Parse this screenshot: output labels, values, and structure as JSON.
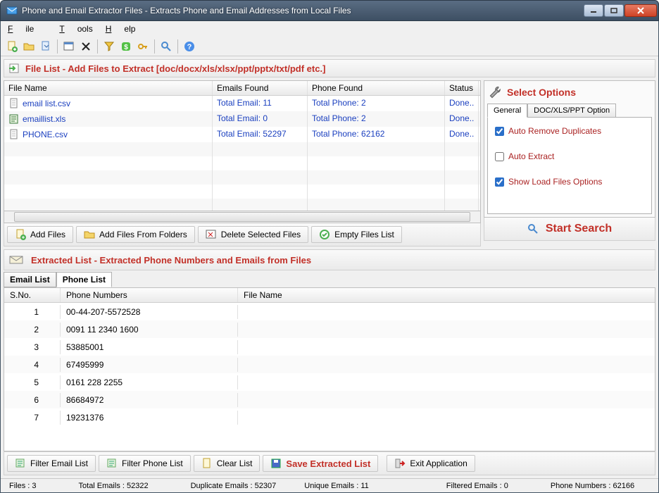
{
  "title": "Phone and Email Extractor Files  -  Extracts Phone and Email Addresses from Local Files",
  "menu": {
    "file": "File",
    "tools": "Tools",
    "help": "Help"
  },
  "panel1_title": "File List - Add Files to Extract  [doc/docx/xls/xlsx/ppt/pptx/txt/pdf etc.]",
  "file_cols": {
    "name": "File Name",
    "emails": "Emails Found",
    "phone": "Phone Found",
    "status": "Status"
  },
  "files": [
    {
      "name": "email list.csv",
      "emails": "Total Email: 11",
      "phone": "Total Phone: 2",
      "status": "Done.."
    },
    {
      "name": "emaillist.xls",
      "emails": "Total Email: 0",
      "phone": "Total Phone: 2",
      "status": "Done.."
    },
    {
      "name": "PHONE.csv",
      "emails": "Total Email: 52297",
      "phone": "Total Phone: 62162",
      "status": "Done.."
    }
  ],
  "options_title": "Select Options",
  "options_tabs": {
    "general": "General",
    "doc": "DOC/XLS/PPT Option"
  },
  "options": {
    "auto_remove": "Auto Remove Duplicates",
    "auto_extract": "Auto Extract",
    "show_load": "Show Load Files Options"
  },
  "filebtns": {
    "add": "Add Files",
    "addfolder": "Add Files From Folders",
    "delete": "Delete Selected Files",
    "empty": "Empty Files List"
  },
  "start_search": "Start Search",
  "panel2_title": "Extracted List - Extracted Phone Numbers and Emails from Files",
  "ext_tabs": {
    "email": "Email List",
    "phone": "Phone List"
  },
  "ext_cols": {
    "sn": "S.No.",
    "phone": "Phone Numbers",
    "file": "File Name"
  },
  "ext_rows": [
    {
      "sn": "1",
      "phone": "00-44-207-5572528",
      "file": ""
    },
    {
      "sn": "2",
      "phone": "0091 11 2340 1600",
      "file": ""
    },
    {
      "sn": "3",
      "phone": "53885001",
      "file": ""
    },
    {
      "sn": "4",
      "phone": "67495999",
      "file": ""
    },
    {
      "sn": "5",
      "phone": "0161 228 2255",
      "file": ""
    },
    {
      "sn": "6",
      "phone": "86684972",
      "file": ""
    },
    {
      "sn": "7",
      "phone": "19231376",
      "file": ""
    }
  ],
  "bottom": {
    "filter_email": "Filter Email List",
    "filter_phone": "Filter Phone List",
    "clear": "Clear List",
    "save": "Save Extracted List",
    "exit": "Exit Application"
  },
  "status": {
    "files": "Files :  3",
    "total_emails": "Total Emails :  52322",
    "dup_emails": "Duplicate Emails :  52307",
    "unique_emails": "Unique Emails :  11",
    "filtered_emails": "Filtered Emails :  0",
    "phone_numbers": "Phone Numbers :  62166"
  }
}
